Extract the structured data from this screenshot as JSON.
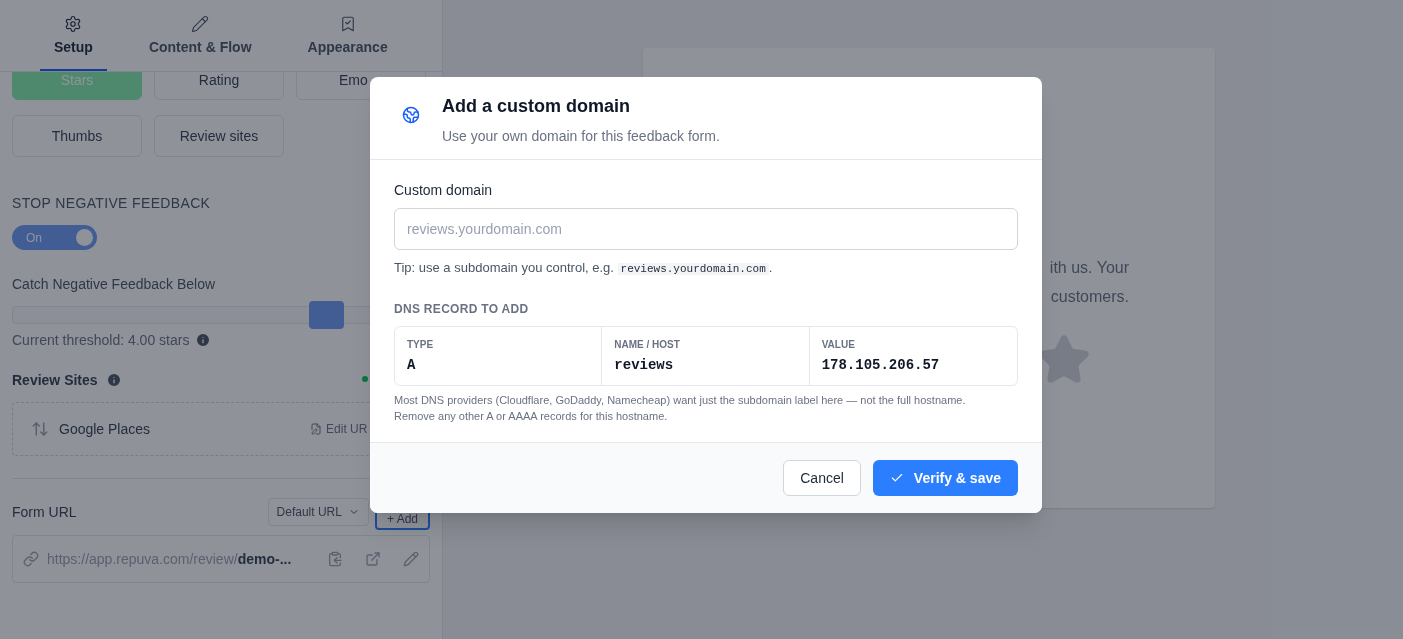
{
  "tabs": [
    {
      "label": "Setup",
      "selected": true
    },
    {
      "label": "Content & Flow",
      "selected": false
    },
    {
      "label": "Appearance",
      "selected": false
    }
  ],
  "rating_types": [
    {
      "label": "Stars",
      "selected": true
    },
    {
      "label": "Rating",
      "selected": false
    },
    {
      "label": "Emo",
      "selected": false
    },
    {
      "label": "Thumbs",
      "selected": false
    },
    {
      "label": "Review sites",
      "selected": false
    }
  ],
  "stop_negative": {
    "heading": "STOP NEGATIVE FEEDBACK",
    "toggle_label": "On",
    "on": true
  },
  "threshold": {
    "label": "Catch Negative Feedback Below",
    "level": 0.75,
    "reading": "Current threshold: 4.00 stars"
  },
  "review_sites": {
    "heading": "Review Sites",
    "items": [
      {
        "name": "Google Places",
        "action": "Edit UR"
      }
    ]
  },
  "form_url": {
    "label": "Form URL",
    "dropdown": "Default URL",
    "add_button": "+ Add",
    "url": "https://app.repuva.com/review/**demo-...**"
  },
  "preview": {
    "lines": [
      "ith us. Your",
      "customers."
    ]
  },
  "dialog": {
    "title": "Add a custom domain",
    "subtitle": "Use your own domain for this feedback form.",
    "field_label": "Custom domain",
    "placeholder": "reviews.yourdomain.com",
    "tip": "Tip: use a subdomain you control, e.g.",
    "tip_code": "reviews.yourdomain.com",
    "tip_end": ".",
    "section": "DNS RECORD TO ADD",
    "record": [
      {
        "label": "TYPE",
        "value": "A"
      },
      {
        "label": "NAME / HOST",
        "value": "reviews"
      },
      {
        "label": "VALUE",
        "value": "178.105.206.57"
      }
    ],
    "note": "Most DNS providers (Cloudflare, GoDaddy, Namecheap) want just the subdomain label here — not the full hostname. Remove any other A or AAAA records for this hostname.",
    "buttons": [
      {
        "label": "Cancel",
        "kind": "secondary"
      },
      {
        "label": "Verify & save",
        "kind": "primary"
      }
    ]
  }
}
